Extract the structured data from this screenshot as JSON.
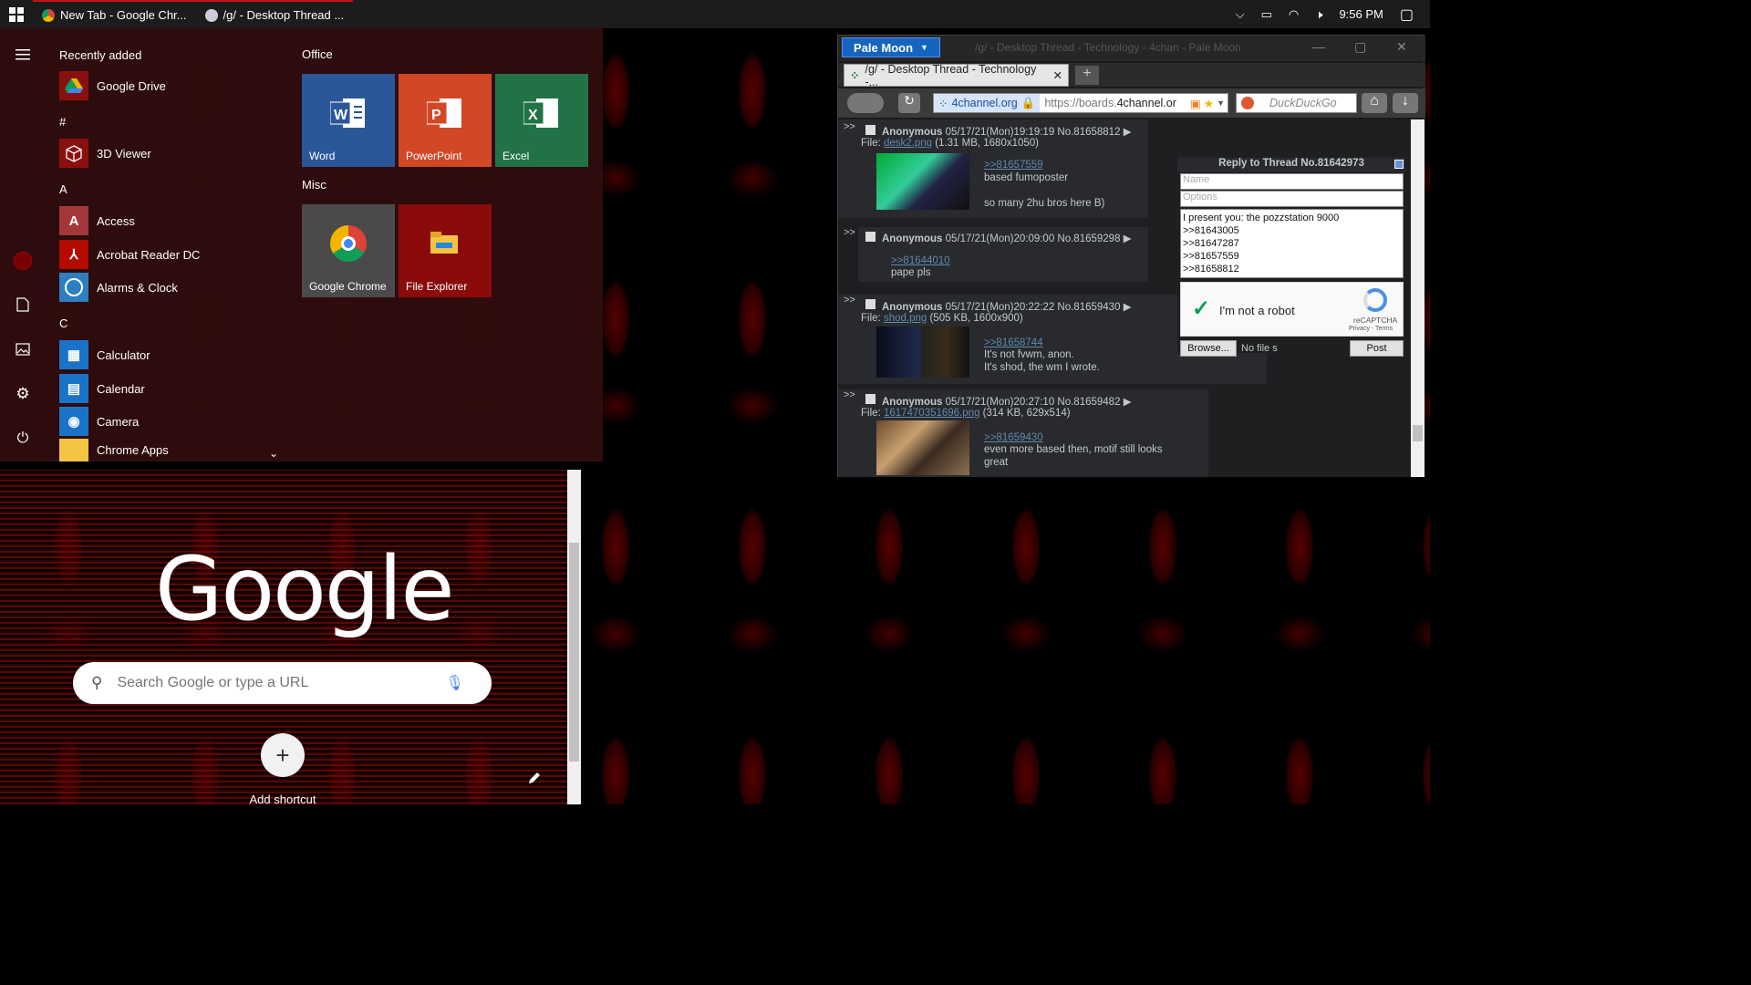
{
  "taskbar": {
    "tabs": [
      {
        "label": "New Tab - Google Chr..."
      },
      {
        "label": "/g/ - Desktop Thread ..."
      }
    ],
    "clock": "9:56 PM"
  },
  "start_menu": {
    "recently_added_label": "Recently added",
    "recent_app": "Google Drive",
    "sections": [
      {
        "header": "#",
        "apps": [
          "3D Viewer"
        ]
      },
      {
        "header": "A",
        "apps": [
          "Access",
          "Acrobat Reader DC",
          "Alarms & Clock"
        ]
      },
      {
        "header": "C",
        "apps": [
          "Calculator",
          "Calendar",
          "Camera",
          "Chrome Apps"
        ]
      }
    ],
    "tile_groups": [
      {
        "name": "Office",
        "tiles": [
          "Word",
          "PowerPoint",
          "Excel"
        ]
      },
      {
        "name": "Misc",
        "tiles": [
          "Google Chrome",
          "File Explorer"
        ]
      }
    ],
    "colors": {
      "word": "#2b579a",
      "powerpoint": "#d24726",
      "excel": "#217346",
      "chrome": "#4a4a4a",
      "file_explorer": "#8b0b0b"
    }
  },
  "chrome": {
    "logo": "Google",
    "search_placeholder": "Search Google or type a URL",
    "add_shortcut": "Add shortcut"
  },
  "palemoon": {
    "menu_button": "Pale Moon",
    "window_title": "/g/ - Desktop Thread - Technology - 4chan - Pale Moon",
    "tab_title": "/g/ - Desktop Thread - Technology -...",
    "url_site": "4channel.org",
    "url_prefix": "https://boards.",
    "url_host": "4channel.or",
    "search_engine": "DuckDuckGo",
    "posts": [
      {
        "name": "Anonymous",
        "meta": "05/17/21(Mon)19:19:19 No.81658812",
        "file_label": "File:",
        "file": "desk2.png",
        "file_info": "(1.31 MB, 1680x1050)",
        "quote": ">>81657559",
        "lines": [
          "based fumoposter",
          "",
          "so many 2hu bros here B)"
        ]
      },
      {
        "name": "Anonymous",
        "meta": "05/17/21(Mon)20:09:00 No.81659298",
        "quote": ">>81644010",
        "lines": [
          "pape pls"
        ]
      },
      {
        "name": "Anonymous",
        "meta": "05/17/21(Mon)20:22:22 No.81659430",
        "file_label": "File:",
        "file": "shod.png",
        "file_info": "(505 KB, 1600x900)",
        "quote": ">>81658744",
        "lines": [
          "It's not fvwm, anon.",
          "It's shod, the wm I wrote."
        ]
      },
      {
        "name": "Anonymous",
        "meta": "05/17/21(Mon)20:27:10 No.81659482",
        "file_label": "File:",
        "file": "1617470351696.png",
        "file_info": "(314 KB, 629x514)",
        "quote": ">>81659430",
        "lines": [
          "even more based then, motif still looks",
          "great"
        ]
      }
    ],
    "reply": {
      "header": "Reply to Thread No.81642973",
      "name_placeholder": "Name",
      "options_placeholder": "Options",
      "comment_lines": [
        "I present you: the pozzstation 9000",
        ">>81643005",
        ">>81647287",
        ">>81657559",
        ">>81658812"
      ],
      "captcha_label": "I'm not a robot",
      "captcha_brand": "reCAPTCHA",
      "captcha_links": "Privacy - Terms",
      "browse": "Browse...",
      "no_file": "No file s",
      "post": "Post"
    }
  }
}
